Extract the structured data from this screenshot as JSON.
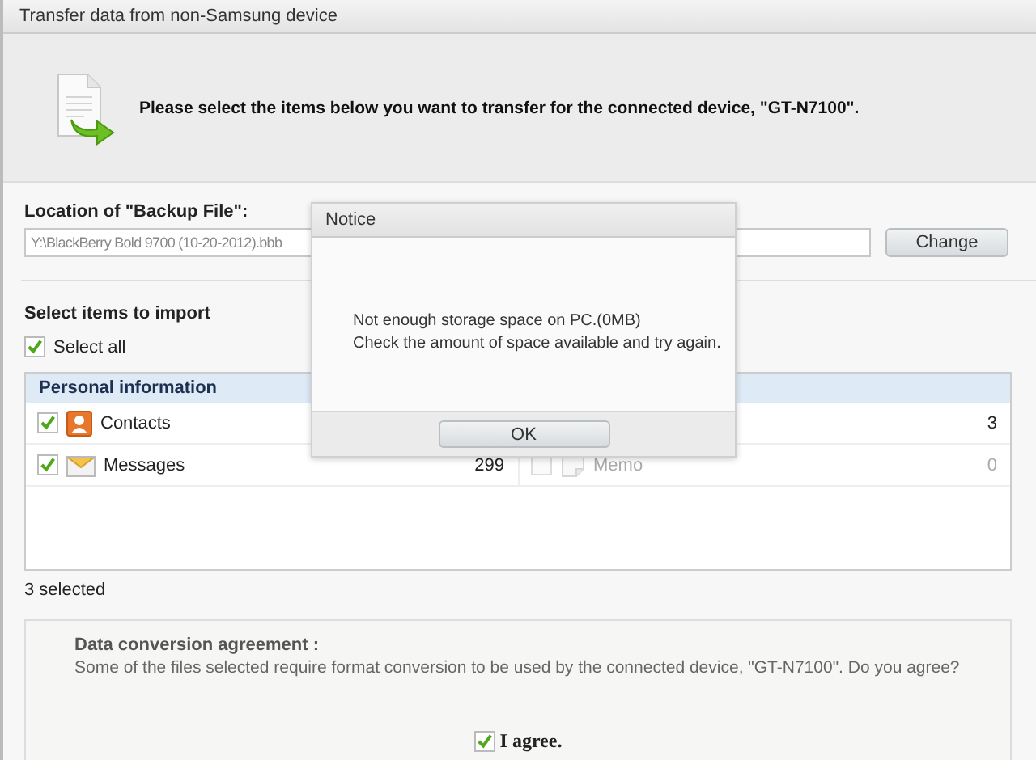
{
  "window": {
    "title": "Transfer data from non-Samsung device"
  },
  "header": {
    "message": "Please select the items below you want to transfer for the connected device, \"GT-N7100\"."
  },
  "backup_location": {
    "label": "Location of \"Backup File\":",
    "value": "Y:\\BlackBerry Bold 9700 (10-20-2012).bbb",
    "button": "Change"
  },
  "import_section": {
    "title": "Select items to import",
    "select_all": {
      "label": "Select all",
      "checked": true
    }
  },
  "category": {
    "title": "Personal information",
    "left_items": [
      {
        "kind": "contacts",
        "label": "Contacts",
        "checked": true,
        "disabled": false
      },
      {
        "kind": "messages",
        "label": "Messages",
        "count": "299",
        "checked": true,
        "disabled": false
      }
    ],
    "right_items": [
      {
        "count": "3",
        "disabled": false
      },
      {
        "kind": "memo",
        "label": "Memo",
        "count": "0",
        "checked": false,
        "disabled": true
      }
    ]
  },
  "selection_count": "3 selected",
  "agreement": {
    "title": "Data conversion agreement :",
    "text": "Some of the files selected require format conversion to be used by the connected device, \"GT-N7100\". Do you agree?",
    "checkbox": {
      "label": "I agree.",
      "checked": true
    }
  },
  "dialog": {
    "title": "Notice",
    "lines": [
      "Not enough storage space on PC.(0MB)",
      "Check the amount of space available and try again."
    ],
    "button": "OK"
  }
}
